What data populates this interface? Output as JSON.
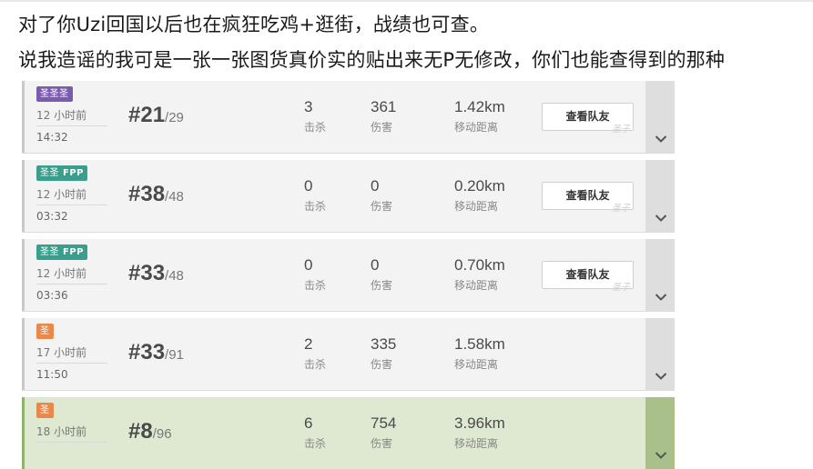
{
  "captions": [
    "对了你Uzi回国以后也在疯狂吃鸡+逛街，战绩也可查。",
    "说我造谣的我可是一张一张图货真价实的贴出来无P无修改，你们也能查得到的那种"
  ],
  "labels": {
    "kills": "击杀",
    "damage": "伤害",
    "distance": "移动距离",
    "view_team": "查看队友",
    "watermark": "圣子"
  },
  "colors": {
    "squad_badge": "#7a5cae",
    "duo_badge": "#3a9e8c",
    "solo_badge": "#e8884a",
    "win_row": "#dfe8d0"
  },
  "matches": [
    {
      "mode_icon": "squad-icon",
      "mode_glyph": "圣圣圣",
      "fpp": "",
      "time_ago": "12 小时前",
      "clock": "14:32",
      "rank": "#21",
      "total": "/29",
      "kills": "3",
      "damage": "361",
      "distance": "1.42km",
      "has_team": true,
      "win": false
    },
    {
      "mode_icon": "duo-icon",
      "mode_glyph": "圣圣",
      "fpp": "FPP",
      "time_ago": "12 小时前",
      "clock": "03:32",
      "rank": "#38",
      "total": "/48",
      "kills": "0",
      "damage": "0",
      "distance": "0.20km",
      "has_team": true,
      "win": false
    },
    {
      "mode_icon": "duo-icon",
      "mode_glyph": "圣圣",
      "fpp": "FPP",
      "time_ago": "12 小时前",
      "clock": "03:36",
      "rank": "#33",
      "total": "/48",
      "kills": "0",
      "damage": "0",
      "distance": "0.70km",
      "has_team": true,
      "win": false
    },
    {
      "mode_icon": "solo-icon",
      "mode_glyph": "圣",
      "fpp": "",
      "time_ago": "17 小时前",
      "clock": "11:50",
      "rank": "#33",
      "total": "/91",
      "kills": "2",
      "damage": "335",
      "distance": "1.58km",
      "has_team": false,
      "win": false
    },
    {
      "mode_icon": "solo-icon",
      "mode_glyph": "圣",
      "fpp": "",
      "time_ago": "18 小时前",
      "clock": "",
      "rank": "#8",
      "total": "/96",
      "kills": "6",
      "damage": "754",
      "distance": "3.96km",
      "has_team": false,
      "win": true
    }
  ]
}
